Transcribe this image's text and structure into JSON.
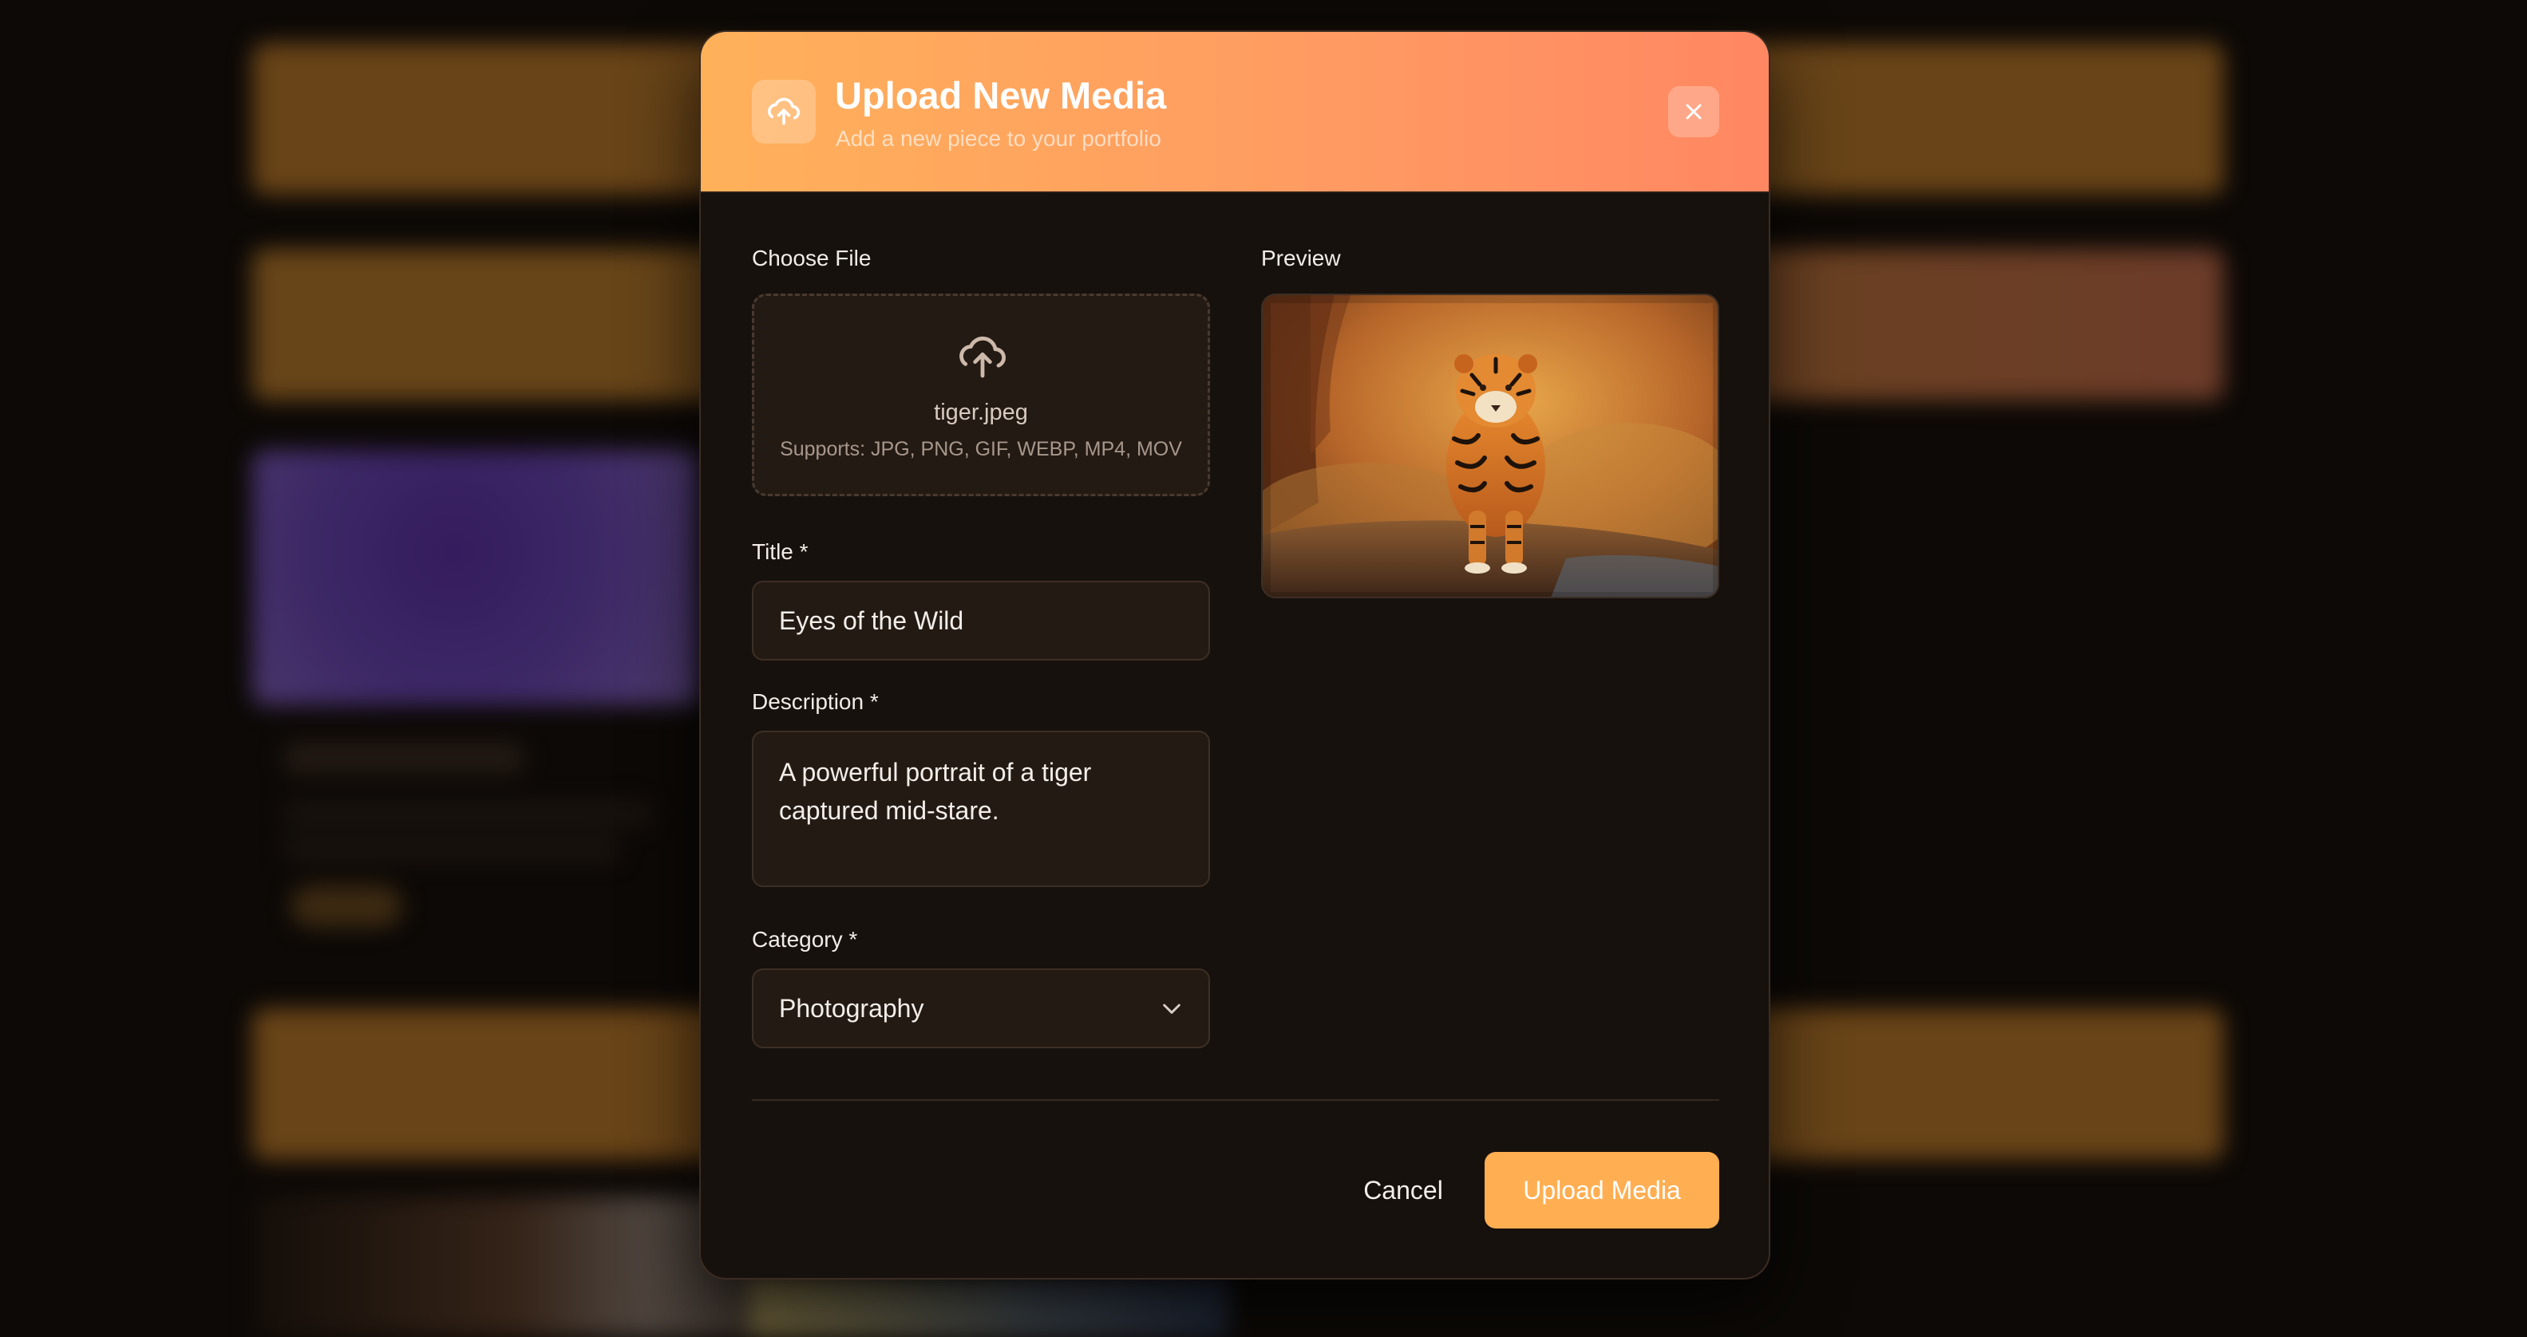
{
  "modal": {
    "title": "Upload New Media",
    "subtitle": "Add a new piece to your portfolio",
    "header_icon": "upload-cloud-icon",
    "close_icon": "close-icon"
  },
  "file": {
    "label": "Choose File",
    "filename": "tiger.jpeg",
    "supports": "Supports: JPG, PNG, GIF, WEBP, MP4, MOV",
    "icon": "upload-cloud-icon"
  },
  "preview": {
    "label": "Preview"
  },
  "title_field": {
    "label": "Title *",
    "value": "Eyes of the Wild"
  },
  "description_field": {
    "label": "Description *",
    "value": "A powerful portrait of a tiger captured mid-stare."
  },
  "category_field": {
    "label": "Category *",
    "value": "Photography",
    "icon": "chevron-down-icon"
  },
  "actions": {
    "cancel_label": "Cancel",
    "upload_label": "Upload Media"
  },
  "colors": {
    "header_start": "#ffb15a",
    "header_end": "#ff8762",
    "accent": "#ffae52",
    "modal_bg": "#17110d",
    "field_bg": "#231a14"
  }
}
